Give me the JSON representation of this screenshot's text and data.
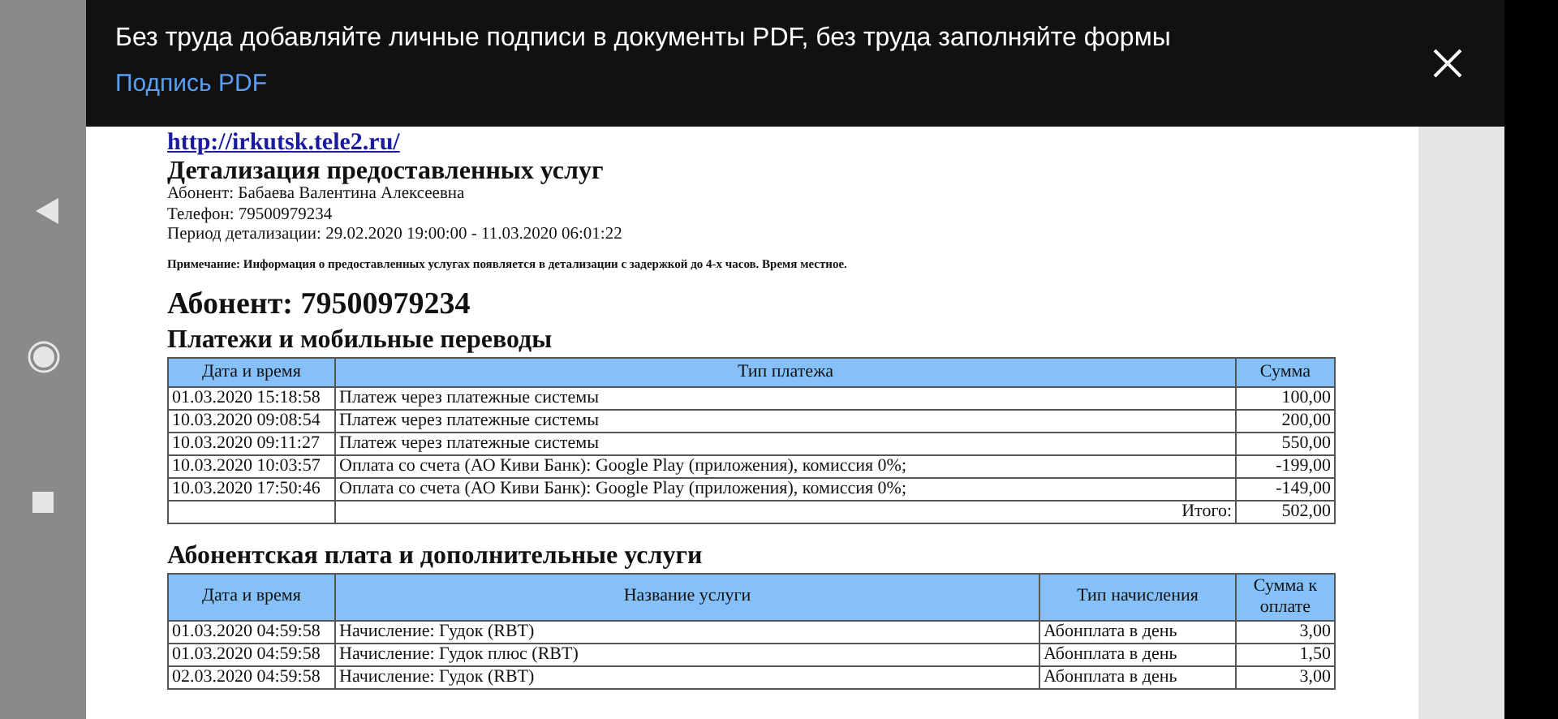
{
  "banner": {
    "message": "Без труда добавляйте личные подписи в документы PDF, без труда заполняйте формы",
    "action": "Подпись PDF"
  },
  "document": {
    "link": "http://irkutsk.tele2.ru/",
    "title": "Детализация предоставленных услуг",
    "info_lines": [
      "Абонент: Бабаева Валентина Алексеевна",
      "Телефон: 79500979234",
      "Период детализации: 29.02.2020 19:00:00 - 11.03.2020 06:01:22"
    ],
    "note": "Примечание: Информация о предоставленных услугах появляется в детализации с задержкой до 4-х часов. Время местное.",
    "subscriber_heading": "Абонент: 79500979234",
    "sections": [
      {
        "title": "Платежи и мобильные переводы",
        "columns": [
          "Дата и время",
          "Тип платежа",
          "Сумма"
        ],
        "rows": [
          [
            "01.03.2020 15:18:58",
            "Платеж через платежные системы",
            "100,00"
          ],
          [
            "10.03.2020 09:08:54",
            "Платеж через платежные системы",
            "200,00"
          ],
          [
            "10.03.2020 09:11:27",
            "Платеж через платежные системы",
            "550,00"
          ],
          [
            "10.03.2020 10:03:57",
            "Оплата со счета (АО Киви Банк): Google Play (приложения), комиссия 0%;",
            "-199,00"
          ],
          [
            "10.03.2020 17:50:46",
            "Оплата со счета (АО Киви Банк): Google Play (приложения), комиссия 0%;",
            "-149,00"
          ]
        ],
        "total": {
          "label": "Итого:",
          "value": "502,00"
        }
      },
      {
        "title": "Абонентская плата и дополнительные услуги",
        "columns": [
          "Дата и время",
          "Название услуги",
          "Тип начисления",
          "Сумма к оплате"
        ],
        "rows": [
          [
            "01.03.2020 04:59:58",
            "Начисление: Гудок (RBT)",
            "Абонплата в день",
            "3,00"
          ],
          [
            "01.03.2020 04:59:58",
            "Начисление: Гудок плюс (RBT)",
            "Абонплата в день",
            "1,50"
          ],
          [
            "02.03.2020 04:59:58",
            "Начисление: Гудок (RBT)",
            "Абонплата в день",
            "3,00"
          ]
        ]
      }
    ]
  }
}
